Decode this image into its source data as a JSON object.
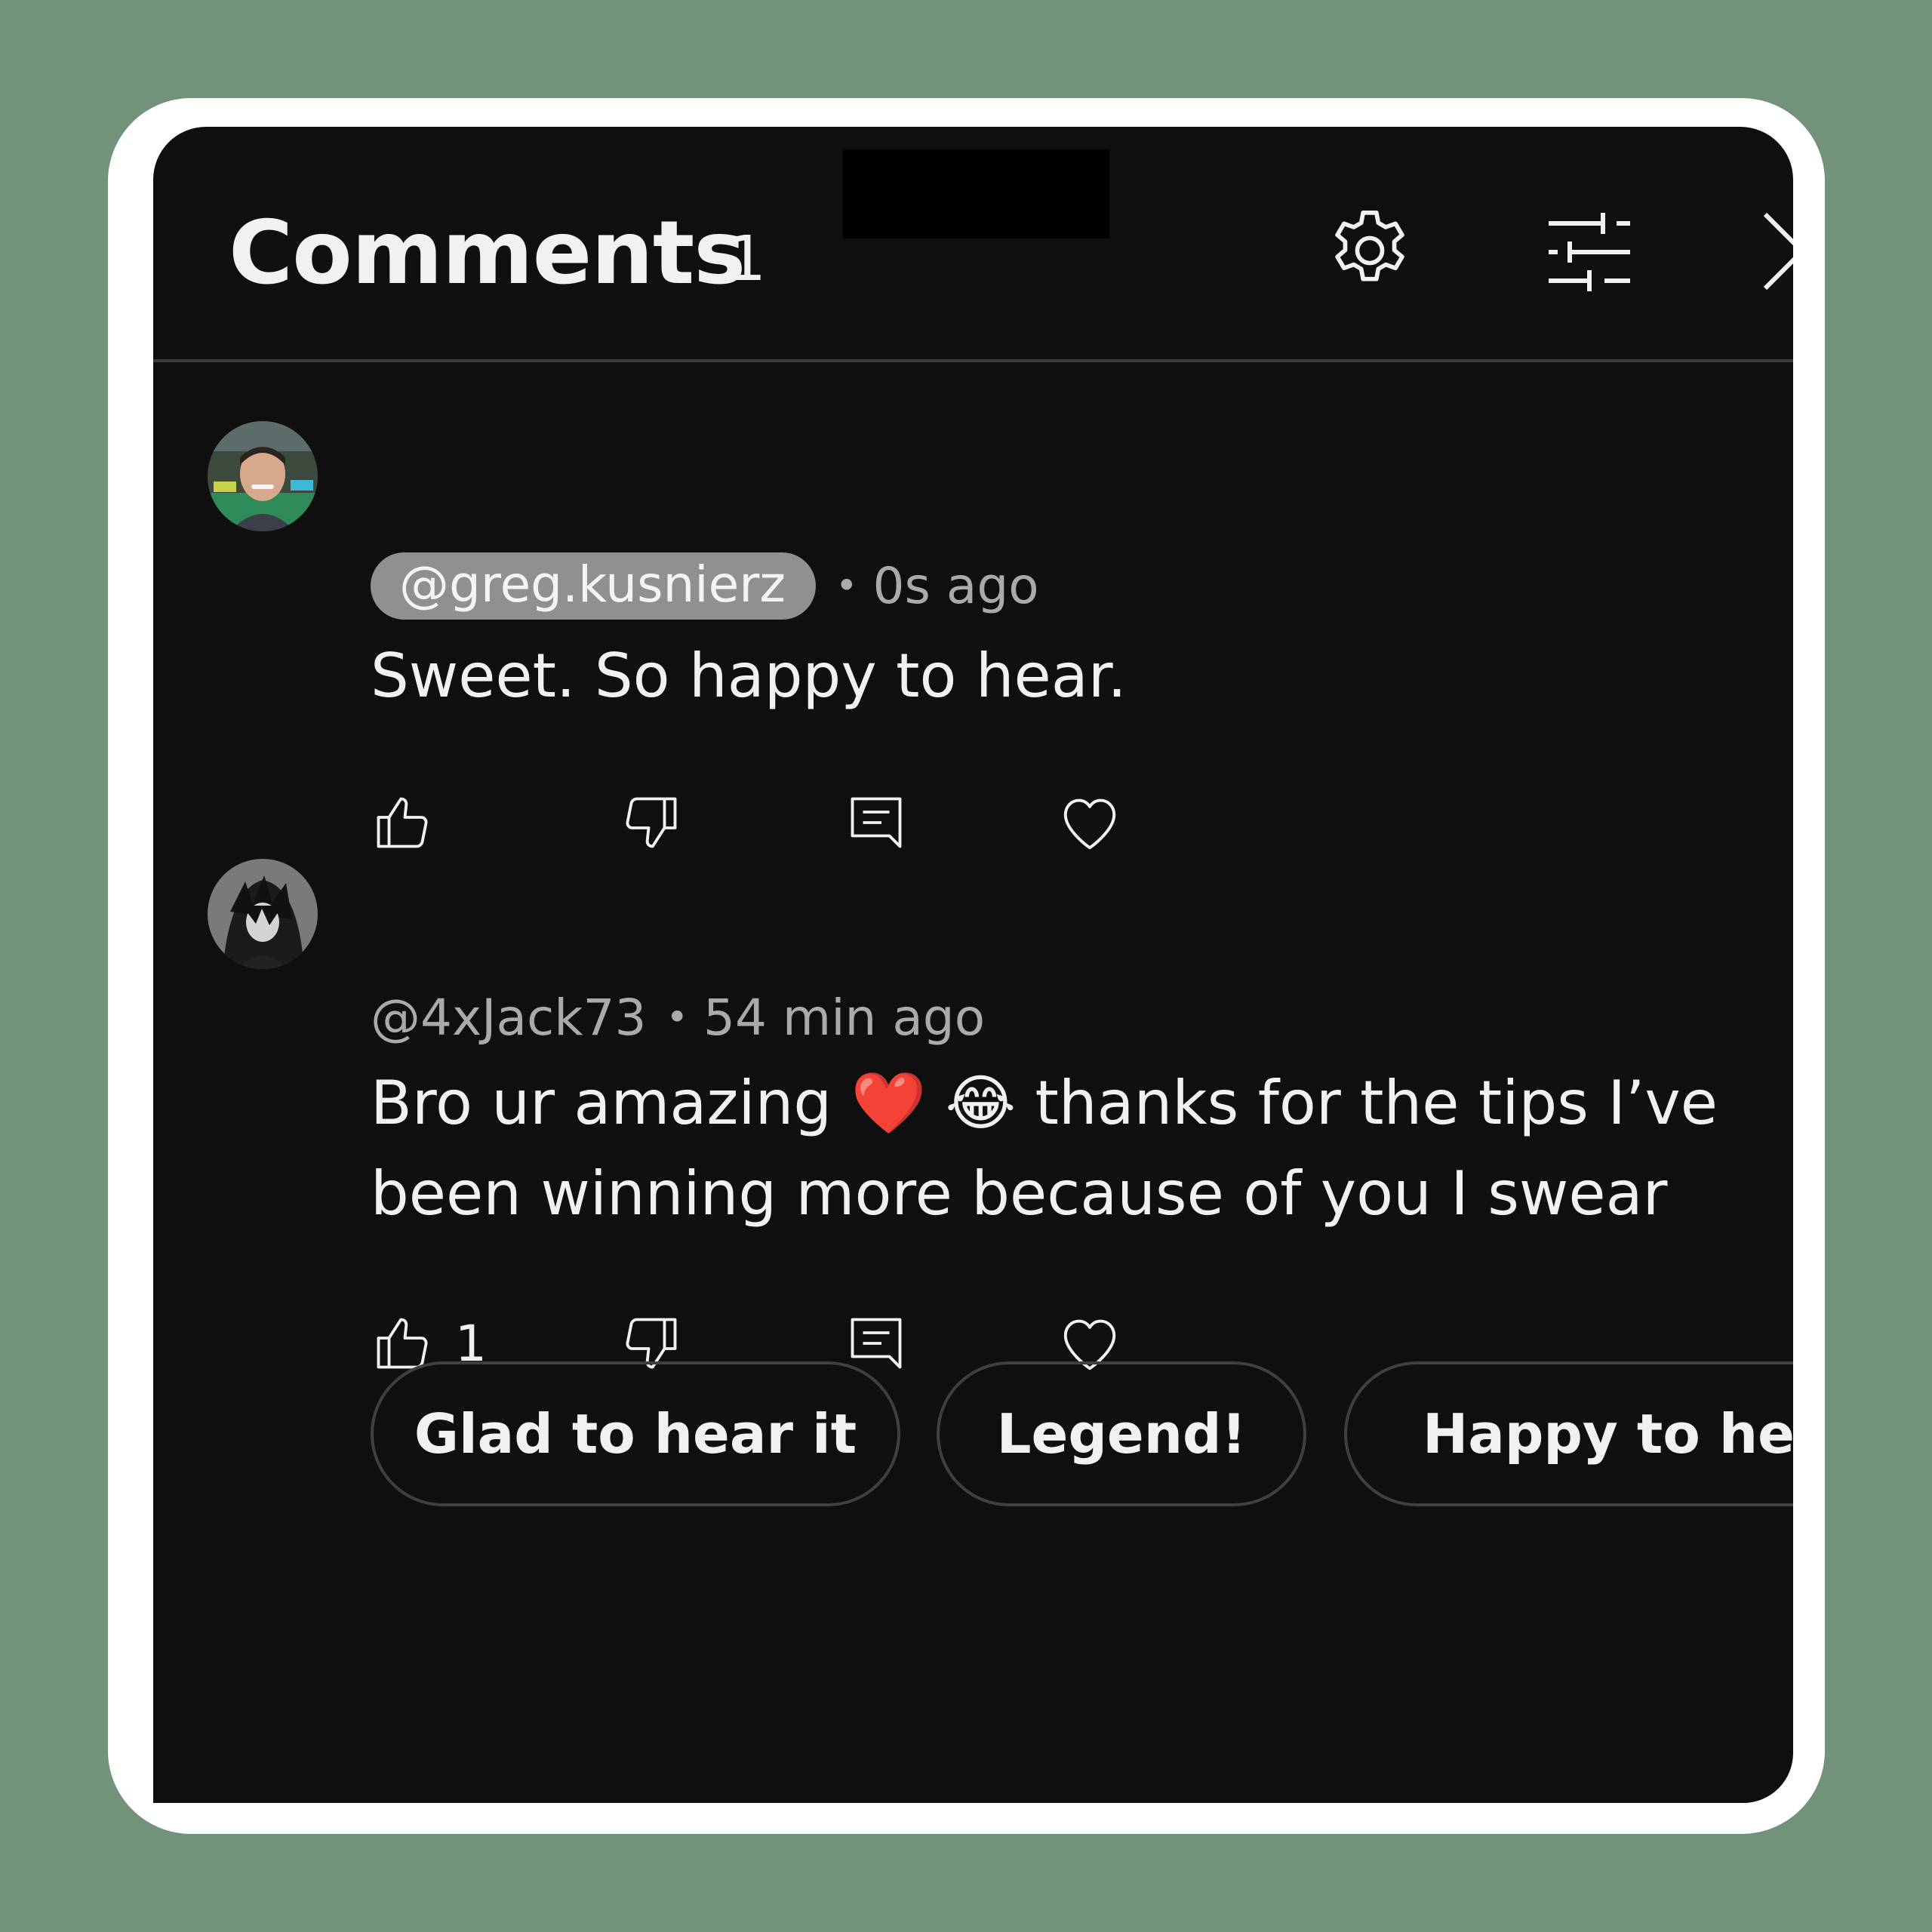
{
  "header": {
    "title": "Comments",
    "count": "1"
  },
  "comments": [
    {
      "handle": "@greg.kusnierz",
      "time": "0s ago",
      "text": "Sweet. So happy to hear.",
      "likes": ""
    },
    {
      "handle": "@4xJack73",
      "time": "54 min ago",
      "line1": "Bro ur amazing ❤️ 😂 thanks for the tips I’ve",
      "line2": "been winning more because of you I swear",
      "likes": "1"
    }
  ],
  "separator": "•",
  "reply_suggestions": [
    "Glad to hear it",
    "Legend!",
    "Happy to help"
  ],
  "icons": {
    "settings": "gear-icon",
    "filter": "sliders-icon",
    "close": "close-icon",
    "like": "thumbs-up-icon",
    "dislike": "thumbs-down-icon",
    "reply": "reply-icon",
    "heart": "heart-icon"
  },
  "colors": {
    "background": "#72927a",
    "panel": "#0f0f0f",
    "text": "#f1f1f1",
    "muted": "#aaaaaa",
    "pill": "#909090"
  }
}
